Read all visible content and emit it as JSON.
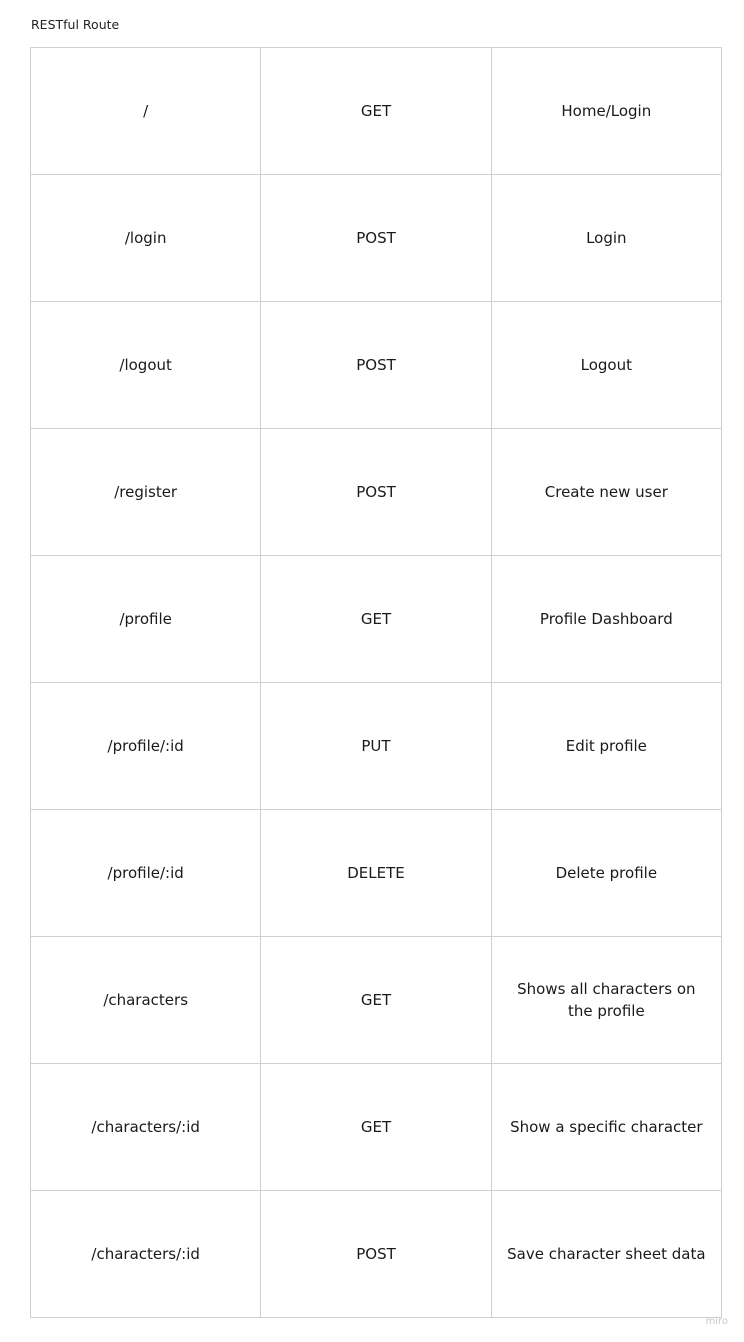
{
  "title": "RESTful Route",
  "watermark": "miro",
  "rows": [
    {
      "path": "/",
      "method": "GET",
      "description": "Home/Login"
    },
    {
      "path": "/login",
      "method": "POST",
      "description": "Login"
    },
    {
      "path": "/logout",
      "method": "POST",
      "description": "Logout"
    },
    {
      "path": "/register",
      "method": "POST",
      "description": "Create new user"
    },
    {
      "path": "/profile",
      "method": "GET",
      "description": "Profile Dashboard"
    },
    {
      "path": "/profile/:id",
      "method": "PUT",
      "description": "Edit profile"
    },
    {
      "path": "/profile/:id",
      "method": "DELETE",
      "description": "Delete profile"
    },
    {
      "path": "/characters",
      "method": "GET",
      "description": "Shows all characters on the profile"
    },
    {
      "path": "/characters/:id",
      "method": "GET",
      "description": "Show a specific character"
    },
    {
      "path": "/characters/:id",
      "method": "POST",
      "description": "Save character sheet data"
    }
  ]
}
